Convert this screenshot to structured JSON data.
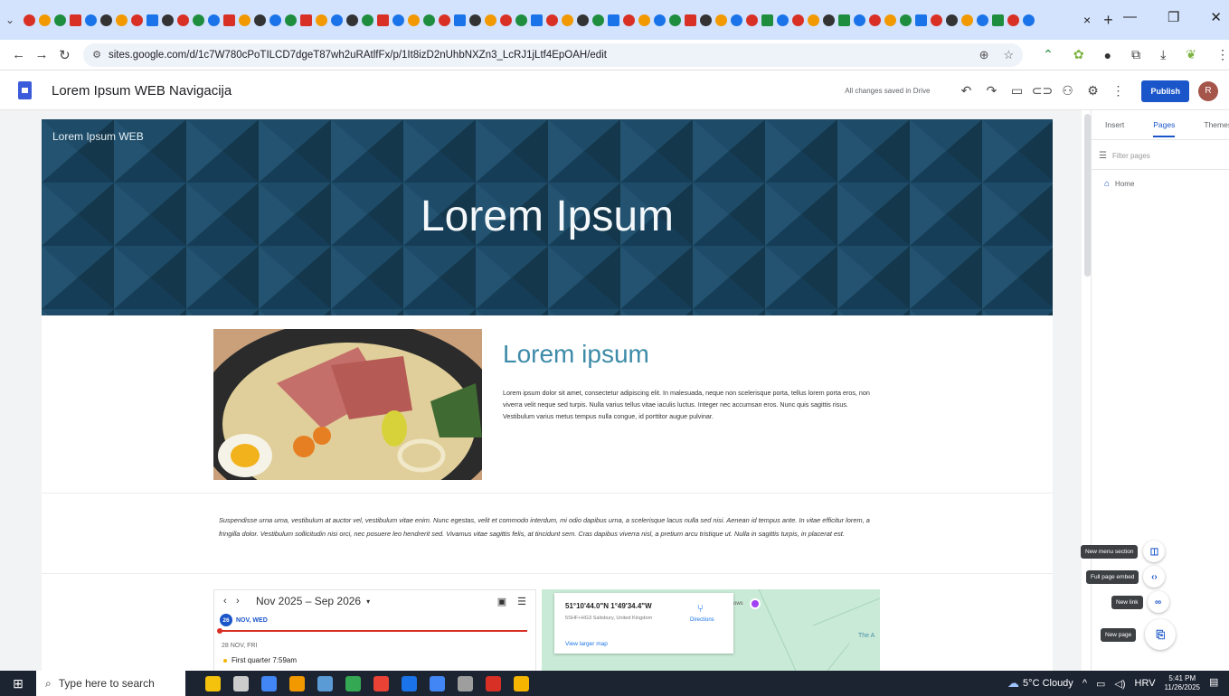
{
  "browser": {
    "url": "sites.google.com/d/1c7W780cPoTILCD7dgeT87wh2uRAtlfFx/p/1It8izD2nUhbNXZn3_LcRJ1jLtf4EpOAH/edit",
    "tab_close_glyph": "×",
    "new_tab_glyph": "+",
    "favicon_colors": [
      "#d93025",
      "#f29900",
      "#1e8e3e",
      "#d93025",
      "#1a73e8",
      "#333",
      "#f29900",
      "#d93025",
      "#1a73e8",
      "#333",
      "#d93025",
      "#1e8e3e",
      "#1a73e8",
      "#d93025",
      "#f29900",
      "#333",
      "#1a73e8",
      "#1e8e3e",
      "#d93025",
      "#f29900",
      "#1a73e8",
      "#333",
      "#1e8e3e",
      "#d93025",
      "#1a73e8",
      "#f29900",
      "#1e8e3e",
      "#d93025",
      "#1a73e8",
      "#333",
      "#f29900",
      "#d93025",
      "#1e8e3e",
      "#1a73e8",
      "#d93025",
      "#f29900",
      "#333",
      "#1e8e3e",
      "#1a73e8",
      "#d93025",
      "#f29900",
      "#1a73e8",
      "#1e8e3e",
      "#d93025",
      "#333",
      "#f29900",
      "#1a73e8",
      "#d93025",
      "#1e8e3e",
      "#1a73e8",
      "#d93025",
      "#f29900",
      "#333",
      "#1e8e3e",
      "#1a73e8",
      "#d93025",
      "#f29900",
      "#1e8e3e",
      "#1a73e8",
      "#d93025",
      "#333",
      "#f29900",
      "#1a73e8",
      "#1e8e3e",
      "#d93025",
      "#1a73e8"
    ]
  },
  "sites_header": {
    "title": "Lorem Ipsum WEB Navigacija",
    "saved_status": "All changes saved in Drive",
    "publish_label": "Publish",
    "avatar_initial": "R"
  },
  "page": {
    "site_name": "Lorem Ipsum WEB",
    "banner_title": "Lorem Ipsum",
    "section_heading": "Lorem ipsum",
    "section_body": "Lorem ipsum dolor sit amet, consectetur adipiscing elit. In malesuada, neque non scelerisque porta, tellus lorem porta eros, non viverra velit neque sed turpis. Nulla varius tellus vitae iaculis luctus. Integer nec accumsan eros. Nunc quis sagittis risus. Vestibulum varius metus tempus nulla congue, id porttitor augue pulvinar.",
    "italic_paragraph": "Suspendisse urna urna, vestibulum at auctor vel, vestibulum vitae enim. Nunc egestas, velit et commodo interdum, mi odio dapibus urna, a scelerisque lacus nulla sed nisi. Aenean id tempus ante. In vitae efficitur lorem, a fringilla dolor. Vestibulum sollicitudin nisi orci, nec posuere leo hendrerit sed. Vivamus vitae sagittis felis, at tincidunt sem. Cras dapibus viverra nisl, a pretium arcu tristique ut. Nulla in sagittis turpis, in placerat est."
  },
  "calendar": {
    "prev": "‹",
    "next": "›",
    "range": "Nov 2025 – Sep 2026",
    "today_badge": "26",
    "today_label": "NOV, WED",
    "day_label": "28 NOV, FRI",
    "event": "First quarter 7:59am"
  },
  "map": {
    "coordinates": "51°10'44.0\"N 1°49'34.4\"W",
    "plus_code": "5SHF+HG3 Salisbury, United Kingdom",
    "directions_label": "Directions",
    "larger_map_link": "View larger map",
    "fragment_text": "ows",
    "label_a": "The A"
  },
  "right_panel": {
    "tabs": [
      "Insert",
      "Pages",
      "Themes"
    ],
    "active_tab": "Pages",
    "filter_placeholder": "Filter pages",
    "pages": [
      "Home"
    ]
  },
  "fab_menu": {
    "new_menu_section": "New menu section",
    "full_page_embed": "Full page embed",
    "new_link": "New link",
    "new_page": "New page"
  },
  "taskbar": {
    "search_placeholder": "Type here to search",
    "weather": "5°C  Cloudy",
    "language": "HRV",
    "time": "5:41 PM",
    "date": "11/26/2025",
    "app_colors": [
      "#f4c20d",
      "#cccccc",
      "#4285f4",
      "#f29900",
      "#5b9bd5",
      "#34a853",
      "#ea4335",
      "#1a73e8",
      "#4285f4",
      "#9e9e9e",
      "#d93025",
      "#f4b400"
    ]
  }
}
